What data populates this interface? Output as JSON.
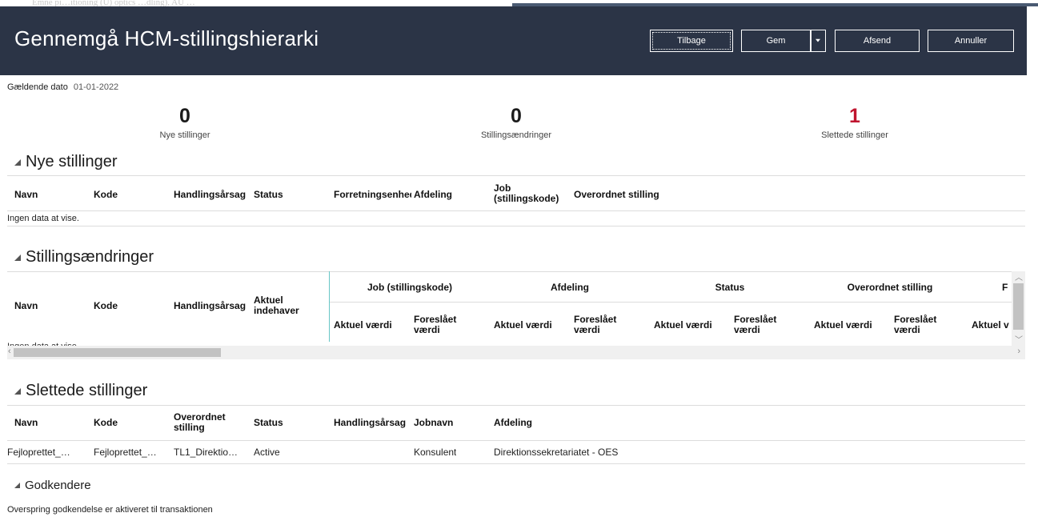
{
  "top_strip": {
    "ghost_text": "Emne pi…itioning (U) optics …dling), AU …"
  },
  "header": {
    "title": "Gennemgå HCM-stillingshierarki",
    "buttons": {
      "back": "Tilbage",
      "save": "Gem",
      "submit": "Afsend",
      "cancel": "Annuller"
    }
  },
  "effective_date": {
    "label": "Gældende dato",
    "value": "01-01-2022"
  },
  "counters": [
    {
      "value": "0",
      "label": "Nye stillinger",
      "highlight": false
    },
    {
      "value": "0",
      "label": "Stillingsændringer",
      "highlight": false
    },
    {
      "value": "1",
      "label": "Slettede stillinger",
      "highlight": true,
      "highlight_color": "#c0152f"
    }
  ],
  "new_positions": {
    "title": "Nye stillinger",
    "columns": [
      "Navn",
      "Kode",
      "Handlingsårsag",
      "Status",
      "Forretningsenhed",
      "Afdeling",
      "Job (stillingskode)",
      "Overordnet stilling"
    ],
    "no_data": "Ingen data at vise."
  },
  "position_changes": {
    "title": "Stillingsændringer",
    "fixed_columns": [
      "Navn",
      "Kode",
      "Handlingsårsag",
      "Aktuel indehaver"
    ],
    "groups": [
      "Job (stillingskode)",
      "Afdeling",
      "Status",
      "Overordnet stilling",
      "F"
    ],
    "sub_current": "Aktuel værdi",
    "sub_proposed": "Foreslået værdi",
    "sub_current_partial": "Aktuel v",
    "no_data_partial": "Ingen data at vise."
  },
  "deleted_positions": {
    "title": "Slettede stillinger",
    "columns": [
      "Navn",
      "Kode",
      "Overordnet stilling",
      "Status",
      "Handlingsårsag",
      "Jobnavn",
      "Afdeling"
    ],
    "rows": [
      [
        "Fejloprettet_…",
        "Fejloprettet_…",
        "TL1_Direktio…",
        "Active",
        "",
        "Konsulent",
        "Direktionssekretariatet - OES"
      ]
    ]
  },
  "approvers": {
    "title": "Godkendere",
    "text": "Overspring godkendelse er aktiveret til transaktionen"
  }
}
